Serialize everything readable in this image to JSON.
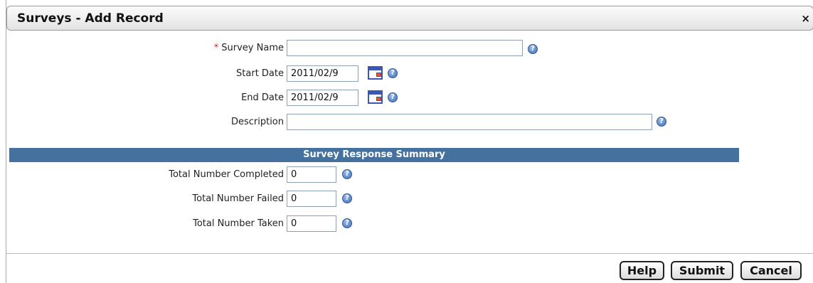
{
  "dialog": {
    "title": "Surveys - Add Record",
    "close_label": "×"
  },
  "form": {
    "survey_name": {
      "required_marker": "*",
      "label": "Survey Name",
      "value": ""
    },
    "start_date": {
      "label": "Start Date",
      "value": "2011/02/9"
    },
    "end_date": {
      "label": "End Date",
      "value": "2011/02/9"
    },
    "description": {
      "label": "Description",
      "value": ""
    }
  },
  "summary": {
    "heading": "Survey Response Summary",
    "completed": {
      "label": "Total Number Completed",
      "value": "0"
    },
    "failed": {
      "label": "Total Number Failed",
      "value": "0"
    },
    "taken": {
      "label": "Total Number Taken",
      "value": "0"
    }
  },
  "buttons": {
    "help": "Help",
    "submit": "Submit",
    "cancel": "Cancel"
  },
  "icons": {
    "help": "help-icon",
    "calendar": "calendar-icon",
    "close": "close-icon"
  },
  "colors": {
    "section_header": "#44719e",
    "required": "#dd2222"
  }
}
